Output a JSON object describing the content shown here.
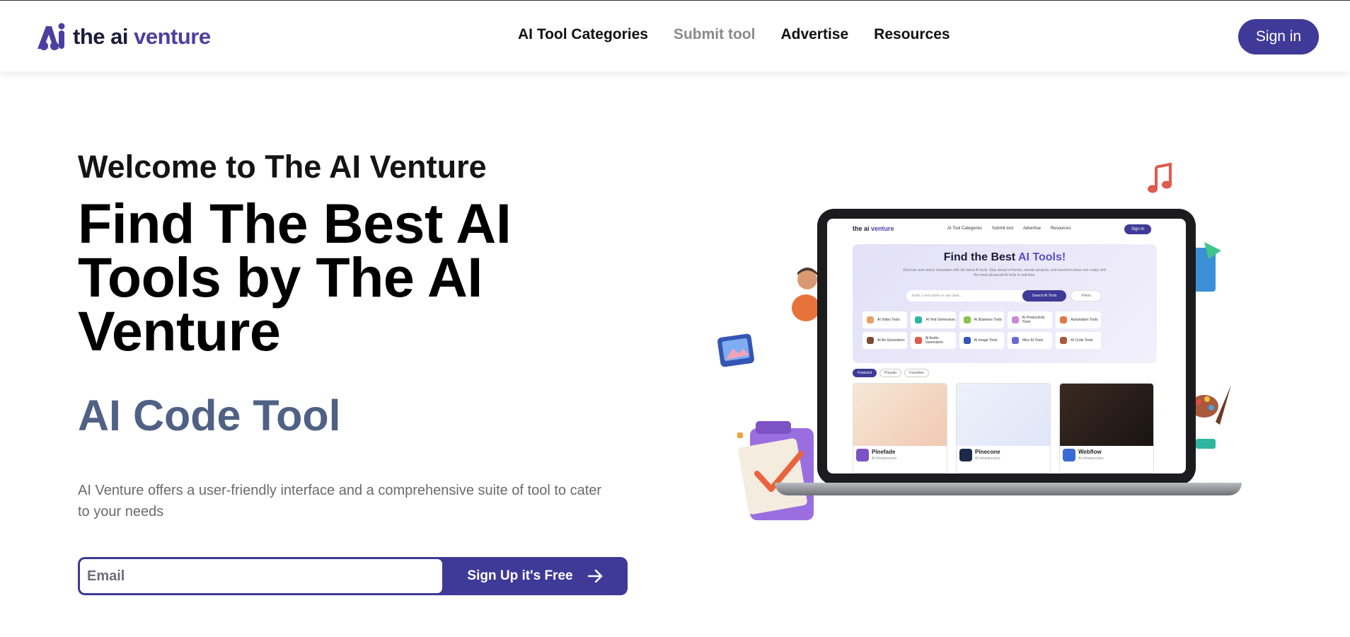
{
  "brand": {
    "name_part1": "the ai ",
    "name_part2": "venture",
    "mark_color": "#4b3fa0"
  },
  "nav": {
    "items": [
      {
        "label": "AI Tool Categories"
      },
      {
        "label": "Submit tool"
      },
      {
        "label": "Advertise"
      },
      {
        "label": "Resources"
      }
    ],
    "signin_label": "Sign in"
  },
  "hero": {
    "welcome": "Welcome to The AI Venture",
    "headline": "Find The Best AI Tools by The AI Venture",
    "rotating_text": "AI Code Tool",
    "description": "AI Venture offers a user-friendly interface and a comprehensive suite of tool to cater to your needs",
    "email_placeholder": "Email",
    "signup_label": "Sign Up it's Free"
  },
  "illustration": {
    "brand_part1": "the ai ",
    "brand_part2": "venture",
    "nav": [
      "AI Tool Categories",
      "Submit tool",
      "Advertise",
      "Resources"
    ],
    "signin": "Sign in",
    "title_part1": "Find the Best ",
    "title_part2": "AI Tools!",
    "subtitle": "Discover and unlock innovation with the latest AI tools. Stay ahead of trends, elevate projects, and transform ideas into reality with the most advanced AI tools in real-time.",
    "search_placeholder": "Enter a tool name or use case...",
    "search_button": "Search AI Tools",
    "filters": "Filters",
    "categories": [
      "AI Video Tools",
      "AI Text Generators",
      "AI Business Tools",
      "AI Productivity Tools",
      "Automation Tools",
      "",
      "AI Art Generators",
      "AI Audio Generators",
      "AI Image Tools",
      "Misc AI Tools",
      "AI Code Tools",
      ""
    ],
    "tabs": [
      "Featured",
      "Popular",
      "Favorites"
    ],
    "cards": [
      {
        "name": "Pinefade",
        "sub": "AI Infrastructure"
      },
      {
        "name": "Pinecone",
        "sub": "AI Infrastructure"
      },
      {
        "name": "Webflow",
        "sub": "AI Infrastructure"
      }
    ]
  },
  "colors": {
    "primary": "#3f3a97",
    "rotating": "#4f6184"
  }
}
